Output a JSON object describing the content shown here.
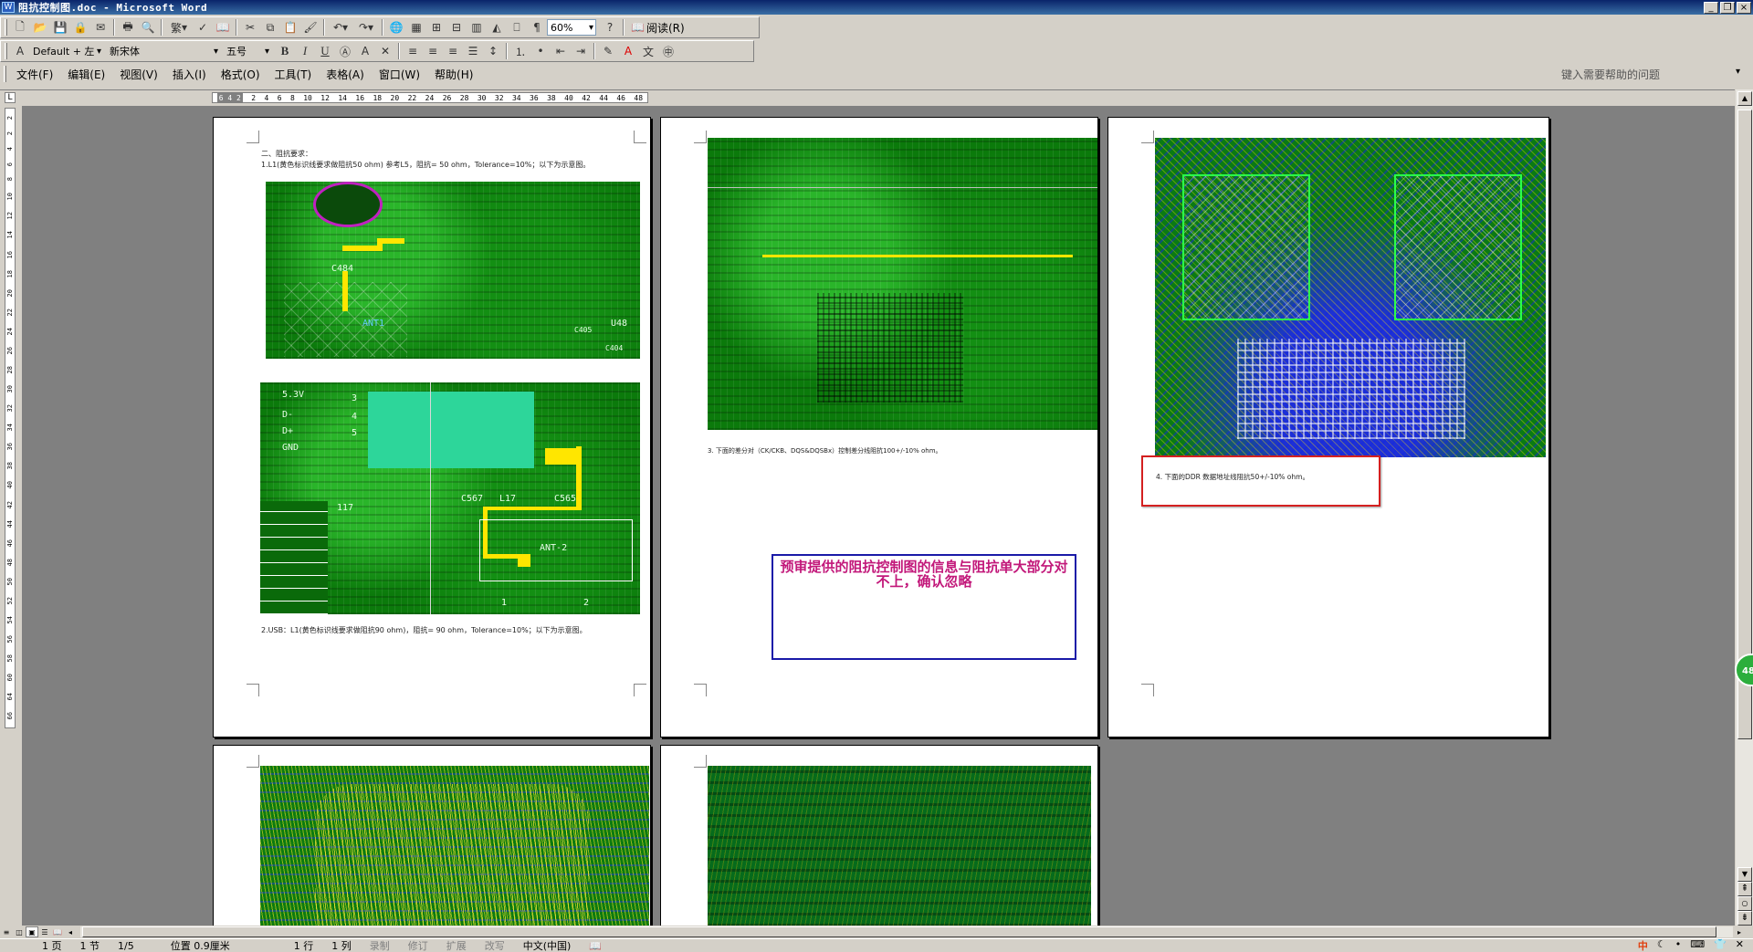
{
  "window": {
    "title": "阻抗控制图.doc - Microsoft Word",
    "app_icon": "word-icon",
    "buttons": [
      "minimize-icon",
      "restore-icon",
      "close-icon"
    ]
  },
  "toolbar_standard": {
    "zoom_value": "60%",
    "read_label": "阅读(R)",
    "traditional_label": "繁"
  },
  "toolbar_format": {
    "style_value": "Default + 左",
    "font_value": "新宋体",
    "size_value": "五号",
    "bold": "B",
    "italic": "I",
    "underline": "U"
  },
  "menu": {
    "items": [
      "文件(F)",
      "编辑(E)",
      "视图(V)",
      "插入(I)",
      "格式(O)",
      "工具(T)",
      "表格(A)",
      "窗口(W)",
      "帮助(H)"
    ],
    "help_placeholder": "键入需要帮助的问题"
  },
  "ruler": {
    "grey_marks": "6 4 2",
    "marks": [
      "2",
      "4",
      "6",
      "8",
      "10",
      "12",
      "14",
      "16",
      "18",
      "20",
      "22",
      "24",
      "26",
      "28",
      "30",
      "32",
      "34",
      "36",
      "38",
      "40",
      "42",
      "44",
      "46",
      "48"
    ],
    "v_marks": [
      "2",
      "2",
      "4",
      "6",
      "8",
      "10",
      "12",
      "14",
      "16",
      "18",
      "20",
      "22",
      "24",
      "26",
      "28",
      "30",
      "32",
      "34",
      "36",
      "38",
      "40",
      "42",
      "44",
      "46",
      "48",
      "50",
      "52",
      "54",
      "56",
      "58",
      "60",
      "64",
      "66"
    ]
  },
  "pages": {
    "p1": {
      "heading": "二、阻抗要求：",
      "line1": "1.L1(黄色标识线要求做阻抗50 ohm) 参考L5，阻抗= 50 ohm，Tolerance=10%；以下为示意图。",
      "fig1_labels": [
        "C484",
        "ANT1",
        "U48",
        "C405",
        "C404"
      ],
      "fig2_labels": [
        "5.3V",
        "D-",
        "D+",
        "GND",
        "117",
        "C567",
        "L17",
        "C565",
        "ANT-2",
        "1",
        "2",
        "3",
        "4",
        "5"
      ],
      "line2": "2.USB：L1(黄色标识线要求做阻抗90 ohm)，阻抗= 90 ohm，Tolerance=10%；以下为示意图。"
    },
    "p2": {
      "line3": "3. 下面的差分对（CK/CKB、DQS&DQSBx）控制差分线阻抗100+/-10% ohm。",
      "comment": "预审提供的阻抗控制图的信息与阻抗单大部分对不上，确认忽略"
    },
    "p3": {
      "line4": "4. 下面的DDR 数据地址线阻抗50+/-10% ohm。"
    }
  },
  "float_badge": "48",
  "statusbar": {
    "page": "1 页",
    "section": "1 节",
    "page_of": "1/5",
    "position": "位置 0.9厘米",
    "line": "1 行",
    "col": "1 列",
    "rec": "录制",
    "trk": "修订",
    "ext": "扩展",
    "ovr": "改写",
    "lang": "中文(中国)",
    "tray_ime": "中",
    "tray_icons": [
      "moon-icon",
      "dot-icon",
      "keyboard-icon",
      "shirt-icon",
      "tool-icon"
    ]
  },
  "colors": {
    "comment_text": "#c2187a",
    "comment_border": "#1a1aa8",
    "red_box": "#d42020",
    "titlebar": "#0a246a"
  }
}
